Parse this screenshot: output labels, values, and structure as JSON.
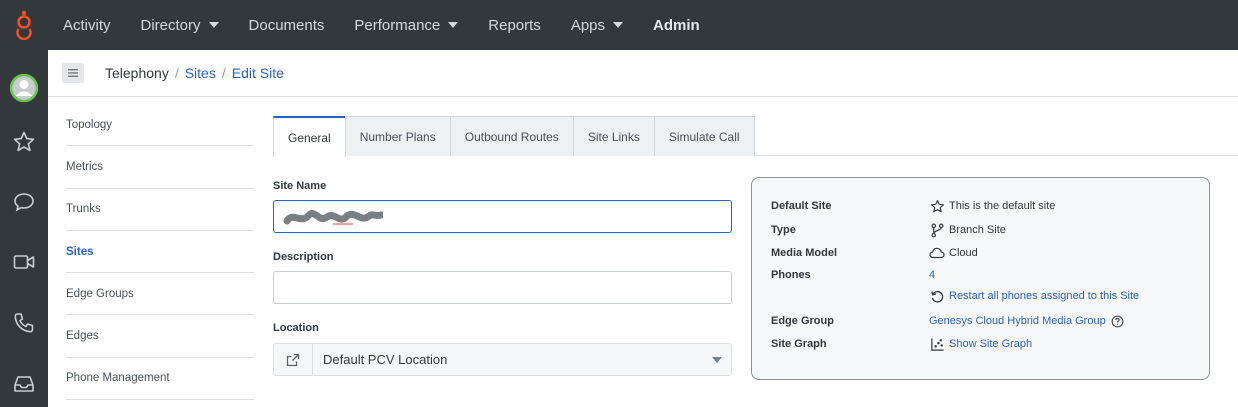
{
  "topnav": {
    "items": [
      {
        "label": "Activity",
        "caret": false
      },
      {
        "label": "Directory",
        "caret": true
      },
      {
        "label": "Documents",
        "caret": false
      },
      {
        "label": "Performance",
        "caret": true
      },
      {
        "label": "Reports",
        "caret": false
      },
      {
        "label": "Apps",
        "caret": true
      },
      {
        "label": "Admin",
        "caret": false
      }
    ]
  },
  "breadcrumb": {
    "root": "Telephony",
    "sep": "/",
    "sites": "Sites",
    "current": "Edit Site"
  },
  "sidenav": {
    "items": [
      "Topology",
      "Metrics",
      "Trunks",
      "Sites",
      "Edge Groups",
      "Edges",
      "Phone Management"
    ],
    "active": "Sites"
  },
  "tabs": [
    "General",
    "Number Plans",
    "Outbound Routes",
    "Site Links",
    "Simulate Call"
  ],
  "form": {
    "site_name_label": "Site Name",
    "site_name_value": "",
    "description_label": "Description",
    "description_value": "",
    "location_label": "Location",
    "location_value": "Default PCV Location"
  },
  "panel": {
    "default_site_key": "Default Site",
    "default_site_val": "This is the default site",
    "type_key": "Type",
    "type_val": "Branch Site",
    "media_model_key": "Media Model",
    "media_model_val": "Cloud",
    "phones_key": "Phones",
    "phones_val": "4",
    "restart_link": "Restart all phones assigned to this Site",
    "edge_group_key": "Edge Group",
    "edge_group_val": "Genesys Cloud Hybrid Media Group",
    "site_graph_key": "Site Graph",
    "site_graph_val": "Show Site Graph"
  },
  "colors": {
    "topbar": "#33383d",
    "accent": "#2a60c8",
    "logo": "#ff4f1f"
  }
}
